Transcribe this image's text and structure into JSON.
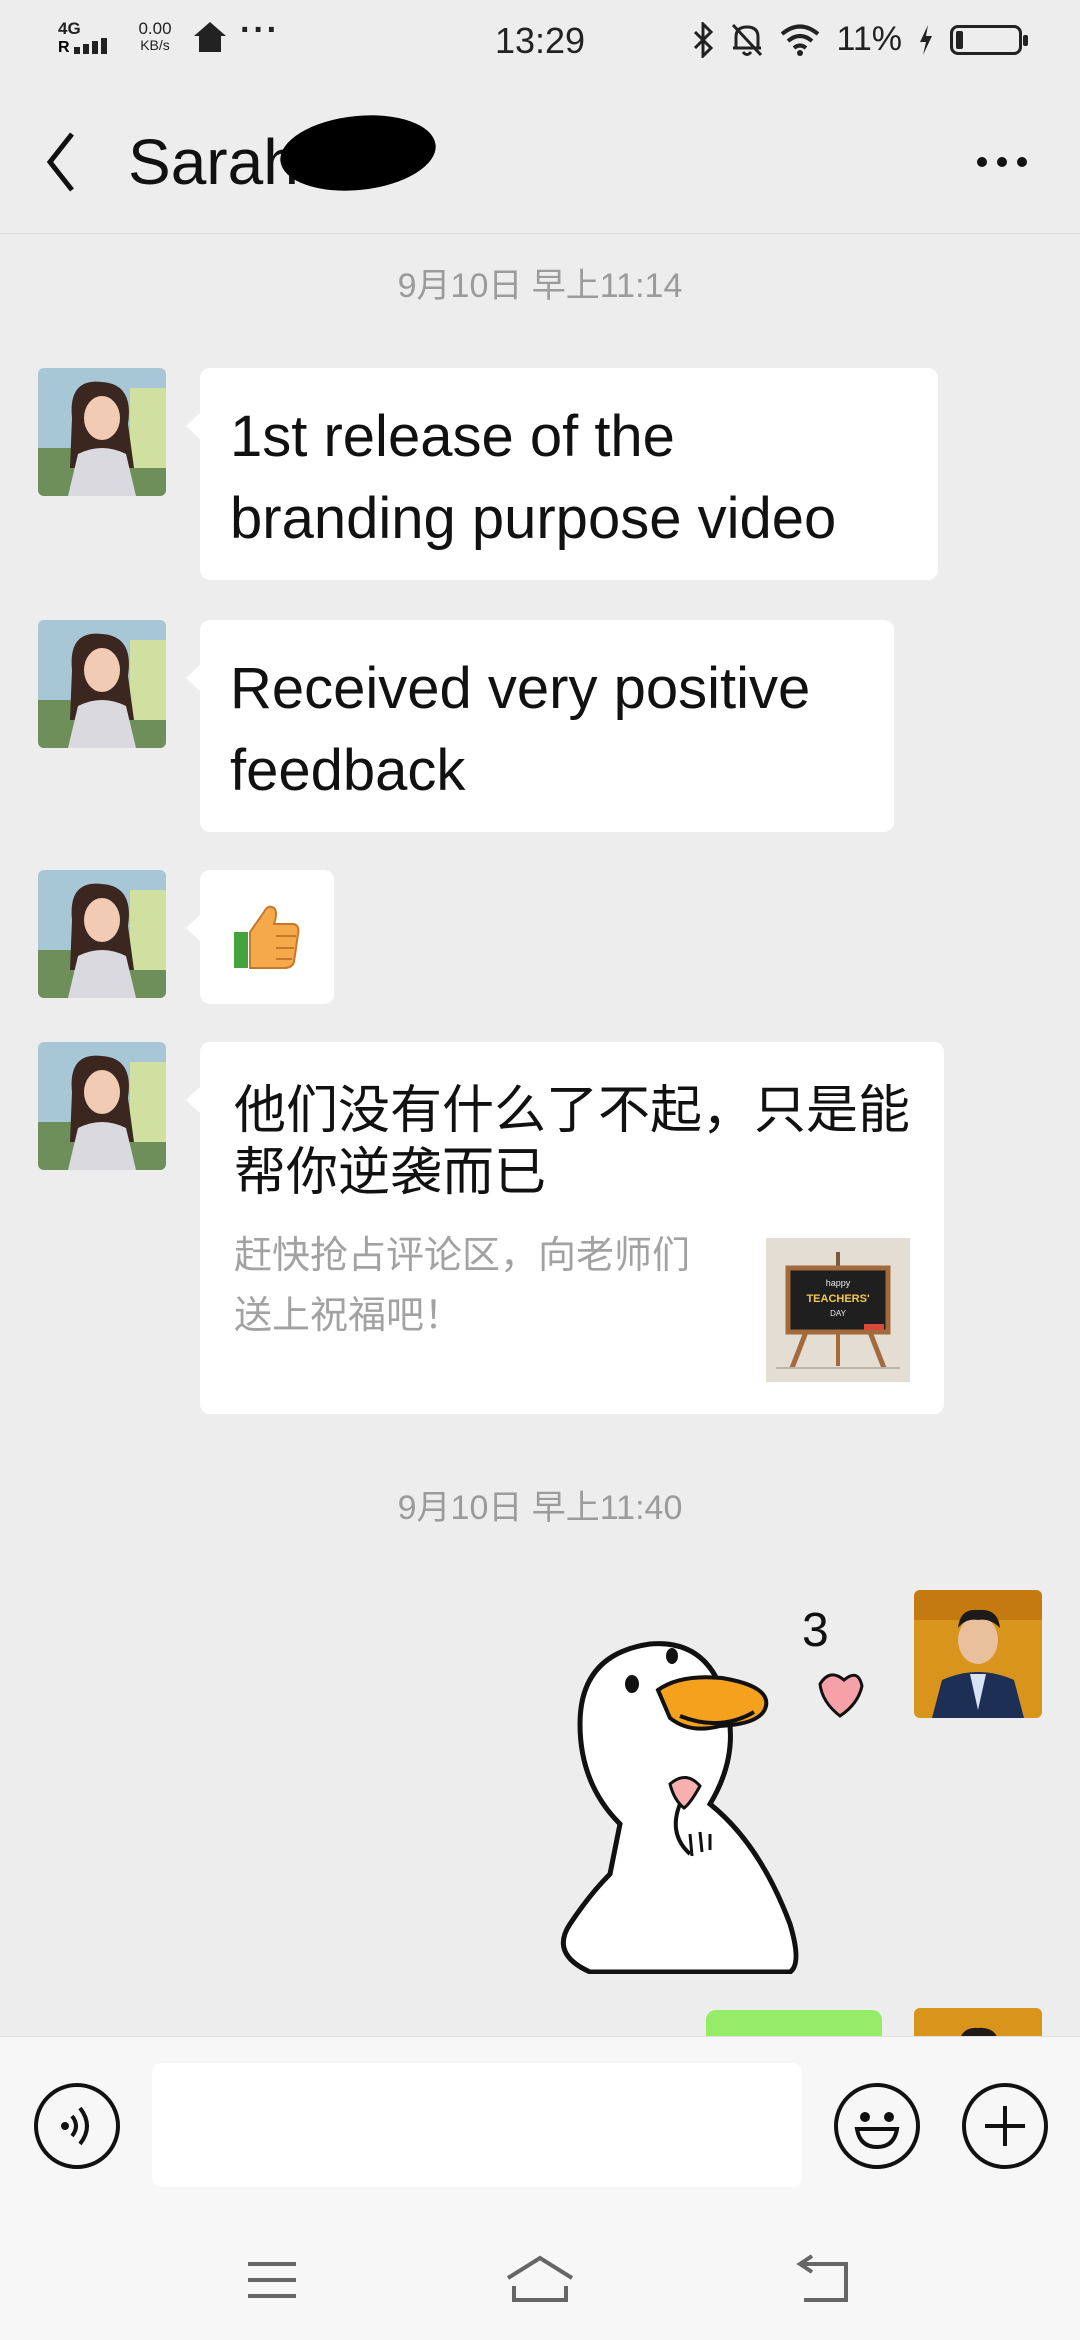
{
  "status_bar": {
    "network": "4G",
    "speed_value": "0.00",
    "speed_unit": "KB/s",
    "overflow": "···",
    "time": "13:29",
    "battery_text": "11%",
    "battery_level": 0.11
  },
  "header": {
    "title": "Sarah",
    "back_icon": "chevron-left-icon",
    "more_icon": "more-dots-icon"
  },
  "messages": {
    "timestamp_1": "9月10日 早上11:14",
    "msg_1": "1st release of the branding purpose video",
    "msg_2": "Received very positive feedback",
    "msg_3_icon": "thumbs-up-emoji",
    "card": {
      "title": "他们没有什么了不起，只是能帮你逆袭而已",
      "description": "赶快抢占评论区，向老师们送上祝福吧！",
      "thumb_text_1": "happy",
      "thumb_text_2": "TEACHERS'",
      "thumb_text_3": "DAY"
    },
    "timestamp_2": "9月10日 早上11:40",
    "sticker_text": "3"
  },
  "input_bar": {
    "voice_icon": "voice-icon",
    "emoji_icon": "emoji-icon",
    "plus_icon": "plus-icon",
    "input_value": ""
  },
  "colors": {
    "background": "#ededed",
    "bubble_incoming": "#ffffff",
    "bubble_outgoing": "#95ec69",
    "timestamp": "#9b9b9b"
  }
}
